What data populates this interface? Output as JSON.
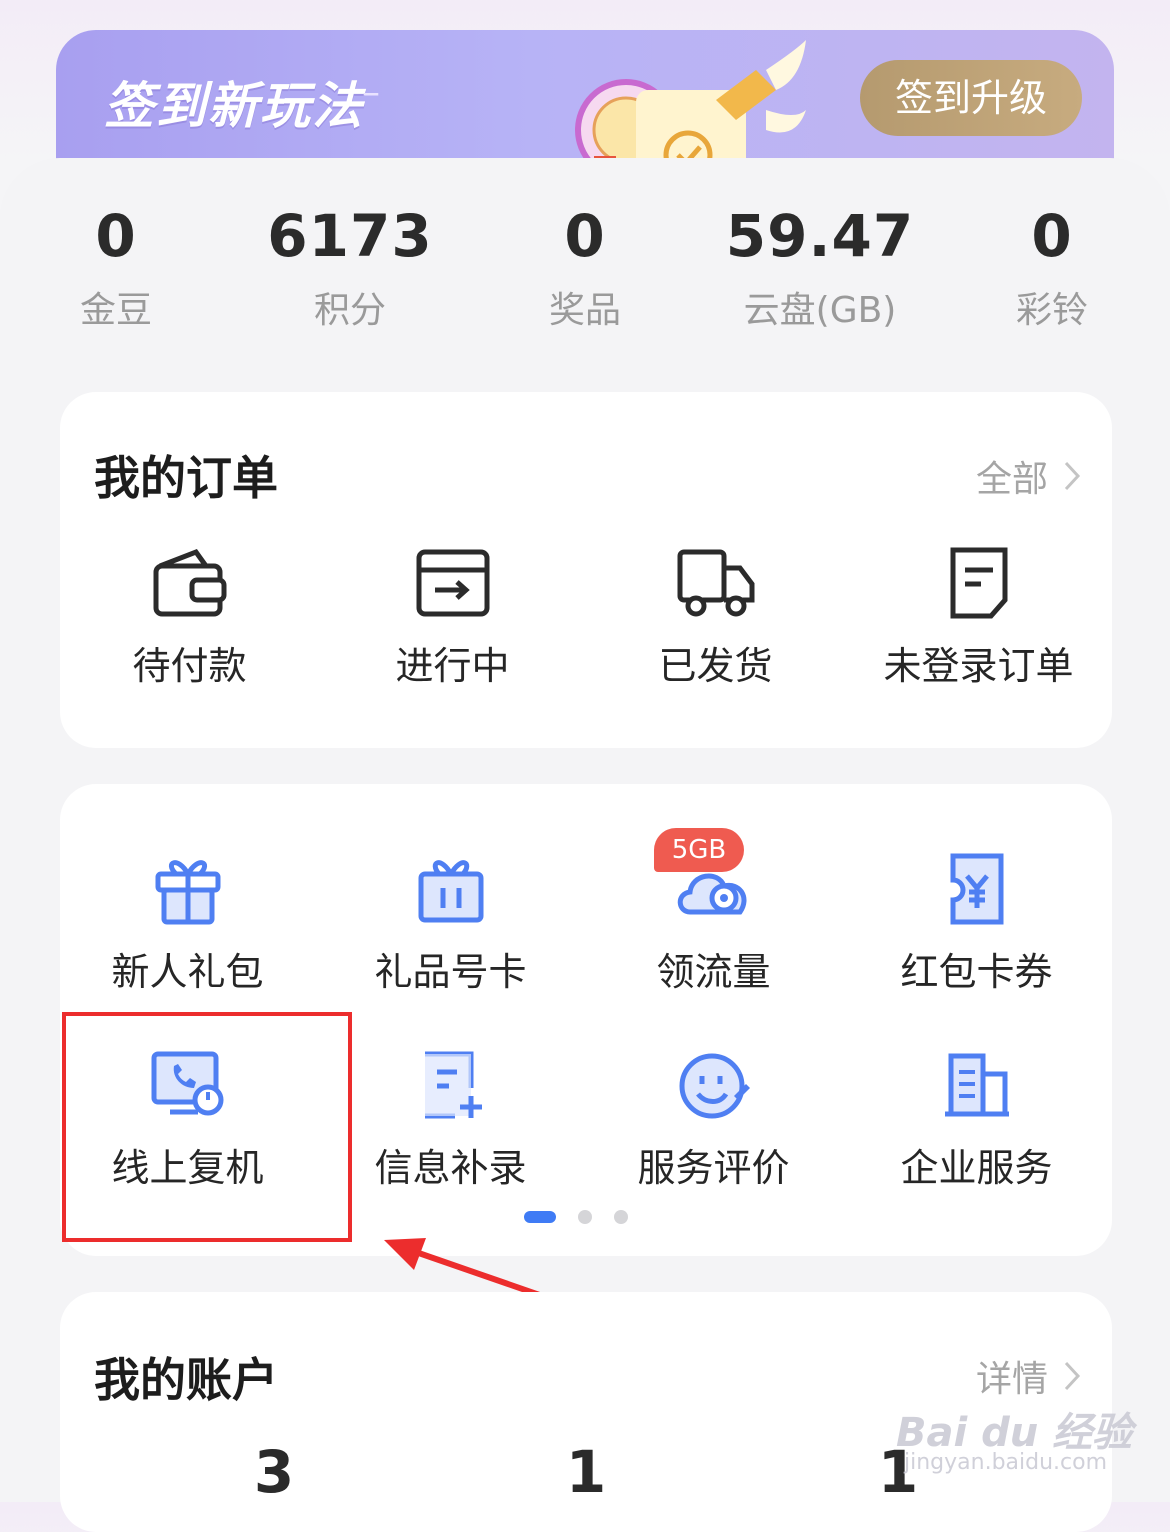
{
  "banner": {
    "title": "签到新玩法",
    "dash": "–",
    "button_label": "签到升级"
  },
  "stats": [
    {
      "value": "0",
      "label": "金豆"
    },
    {
      "value": "6173",
      "label": "积分"
    },
    {
      "value": "0",
      "label": "奖品"
    },
    {
      "value": "59.47",
      "label": "云盘(GB)"
    },
    {
      "value": "0",
      "label": "彩铃"
    }
  ],
  "orders": {
    "title": "我的订单",
    "more_label": "全部",
    "items": [
      {
        "label": "待付款",
        "icon": "wallet-icon"
      },
      {
        "label": "进行中",
        "icon": "box-arrow-icon"
      },
      {
        "label": "已发货",
        "icon": "truck-icon"
      },
      {
        "label": "未登录订单",
        "icon": "document-icon"
      }
    ]
  },
  "services": {
    "badge": "5GB",
    "items": [
      {
        "label": "新人礼包",
        "icon": "gift-icon"
      },
      {
        "label": "礼品号卡",
        "icon": "gift-card-icon"
      },
      {
        "label": "领流量",
        "icon": "cloud-data-icon"
      },
      {
        "label": "红包卡券",
        "icon": "coupon-icon"
      },
      {
        "label": "线上复机",
        "icon": "phone-screen-icon"
      },
      {
        "label": "信息补录",
        "icon": "form-add-icon"
      },
      {
        "label": "服务评价",
        "icon": "smile-rating-icon"
      },
      {
        "label": "企业服务",
        "icon": "building-icon"
      }
    ],
    "page_indicator": {
      "pages": 3,
      "active": 1
    }
  },
  "account": {
    "title": "我的账户",
    "more_label": "详情",
    "values": [
      "3",
      "1",
      "1"
    ]
  },
  "watermark": {
    "text": "Bai du 经验",
    "sub": "jingyan.baidu.com"
  },
  "colors": {
    "accent_blue": "#3f7bf5",
    "badge_red": "#ef5b50",
    "highlight_red": "#ec2d2d",
    "gold_button": "#b59a6f",
    "banner_purple": "#a89ff0"
  }
}
